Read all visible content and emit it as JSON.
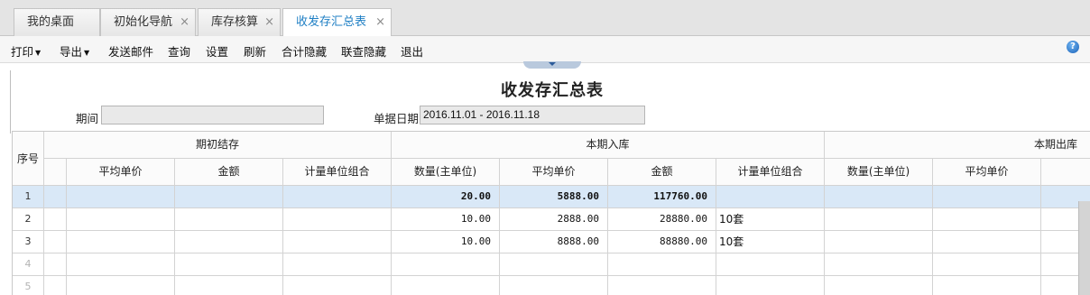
{
  "tabs": [
    {
      "label": "我的桌面",
      "closable": false
    },
    {
      "label": "初始化导航",
      "closable": true
    },
    {
      "label": "库存核算",
      "closable": true
    },
    {
      "label": "收发存汇总表",
      "closable": true,
      "active": true
    }
  ],
  "tab_close_glyph": "×",
  "toolbar": {
    "print": "打印",
    "export": "导出",
    "send_mail": "发送邮件",
    "query": "查询",
    "settings": "设置",
    "refresh": "刷新",
    "subtotal_hide": "合计隐藏",
    "linked_hide": "联查隐藏",
    "exit": "退出",
    "help_glyph": "?"
  },
  "report": {
    "title": "收发存汇总表",
    "period_label": "期间",
    "period_value": "",
    "doc_date_label": "单据日期",
    "doc_date_value": "2016.11.01 - 2016.11.18"
  },
  "grid": {
    "headers": {
      "seq": "序号",
      "group_opening": "期初结存",
      "group_inbound": "本期入库",
      "group_outbound": "本期出库",
      "opening_cols": [
        "平均单价",
        "金额",
        "计量单位组合"
      ],
      "inbound_cols": [
        "数量(主单位)",
        "平均单价",
        "金额",
        "计量单位组合"
      ],
      "outbound_cols": [
        "数量(主单位)",
        "平均单价"
      ]
    },
    "rows": [
      {
        "no": "1",
        "in_qty": "20.00",
        "in_price": "5888.00",
        "in_amount": "117760.00",
        "in_unit": "",
        "selected": true
      },
      {
        "no": "2",
        "in_qty": "10.00",
        "in_price": "2888.00",
        "in_amount": "28880.00",
        "in_unit": "10套"
      },
      {
        "no": "3",
        "in_qty": "10.00",
        "in_price": "8888.00",
        "in_amount": "88880.00",
        "in_unit": "10套"
      },
      {
        "no": "4",
        "in_qty": "",
        "in_price": "",
        "in_amount": "",
        "in_unit": ""
      },
      {
        "no": "5",
        "in_qty": "",
        "in_price": "",
        "in_amount": "",
        "in_unit": ""
      }
    ]
  },
  "colors": {
    "active_tab_text": "#1f7fc4",
    "selected_row": "#d9e8f7"
  }
}
